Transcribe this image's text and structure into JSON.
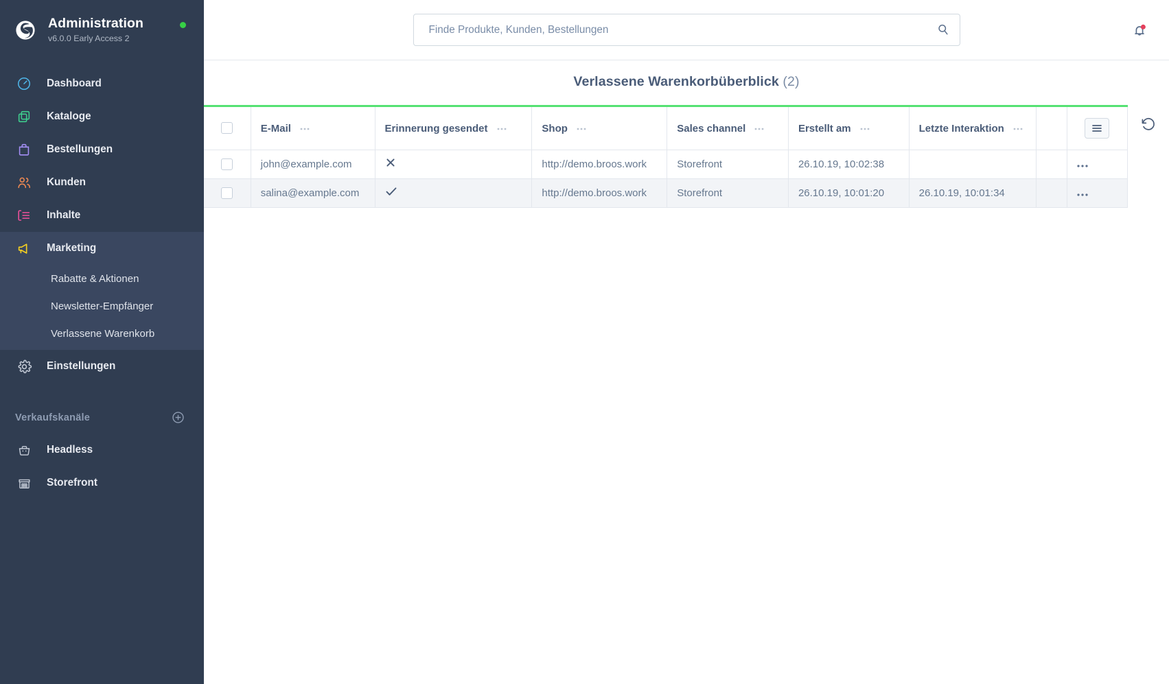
{
  "brand": {
    "logo_icon": "shopware-logo",
    "title": "Administration",
    "version": "v6.0.0 Early Access 2",
    "status_dot_color": "#37d046"
  },
  "sidebar": {
    "background": "#303d51",
    "items": [
      {
        "label": "Dashboard",
        "icon": "speedometer-icon",
        "icon_color": "#4eb5e8",
        "active": false
      },
      {
        "label": "Kataloge",
        "icon": "copy-icon",
        "icon_color": "#3ecf8e",
        "active": false
      },
      {
        "label": "Bestellungen",
        "icon": "bag-icon",
        "icon_color": "#a48ff5",
        "active": false
      },
      {
        "label": "Kunden",
        "icon": "users-icon",
        "icon_color": "#f08a52",
        "active": false
      },
      {
        "label": "Inhalte",
        "icon": "content-icon",
        "icon_color": "#f0509b",
        "active": false
      },
      {
        "label": "Marketing",
        "icon": "megaphone-icon",
        "icon_color": "#f5d020",
        "active": true
      }
    ],
    "subitems": [
      {
        "label": "Rabatte & Aktionen"
      },
      {
        "label": "Newsletter-Empfänger"
      },
      {
        "label": "Verlassene Warenkorb"
      }
    ],
    "settings": {
      "label": "Einstellungen",
      "icon": "gear-icon"
    },
    "sales_channels": {
      "title": "Verkaufskanäle",
      "add_icon": "plus-circle-icon",
      "items": [
        {
          "label": "Headless",
          "icon": "basket-icon"
        },
        {
          "label": "Storefront",
          "icon": "store-icon"
        }
      ]
    }
  },
  "topbar": {
    "search": {
      "placeholder": "Finde Produkte, Kunden, Bestellungen",
      "value": "",
      "icon": "search-icon"
    },
    "notifications": {
      "icon": "bell-icon",
      "badge_color": "#e5405c",
      "has_badge": true
    }
  },
  "page": {
    "title": "Verlassene Warenkorbüberblick",
    "count": "(2)",
    "accent_color": "#55e273"
  },
  "table": {
    "select_all_checkbox": false,
    "columns_button_icon": "columns-menu-icon",
    "refresh_button_icon": "refresh-icon",
    "column_menu_icon": "ellipsis-icon",
    "row_action_icon": "ellipsis-icon",
    "headers": [
      "E-Mail",
      "Erinnerung gesendet",
      "Shop",
      "Sales channel",
      "Erstellt am",
      "Letzte Interaktion"
    ],
    "rows": [
      {
        "selected": false,
        "email": "john@example.com",
        "reminder_sent": false,
        "reminder_icon": "cross-icon",
        "shop": "http://demo.broos.work",
        "sales_channel": "Storefront",
        "created_at": "26.10.19, 10:02:38",
        "last_interaction": ""
      },
      {
        "selected": false,
        "email": "salina@example.com",
        "reminder_sent": true,
        "reminder_icon": "check-icon",
        "shop": "http://demo.broos.work",
        "sales_channel": "Storefront",
        "created_at": "26.10.19, 10:01:20",
        "last_interaction": "26.10.19, 10:01:34"
      }
    ]
  }
}
